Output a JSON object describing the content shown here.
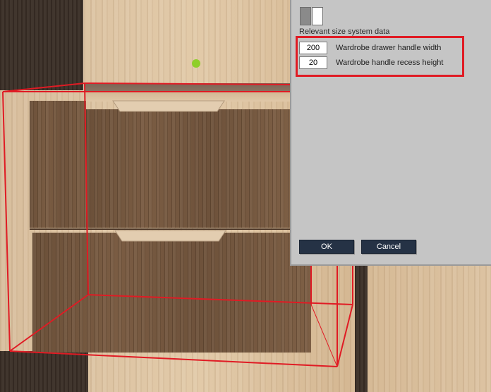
{
  "dialog": {
    "section_label": "Relevant size system data",
    "fields": [
      {
        "value": "200",
        "label": "Wardrobe drawer handle width"
      },
      {
        "value": "20",
        "label": "Wardrobe handle recess height"
      }
    ],
    "ok_label": "OK",
    "cancel_label": "Cancel"
  },
  "colors": {
    "highlight": "#e01b24",
    "wireframe": "#e01b24",
    "button_bg": "#253245",
    "dialog_bg": "#c5c5c5",
    "cursor_dot": "#8fcf2a"
  }
}
